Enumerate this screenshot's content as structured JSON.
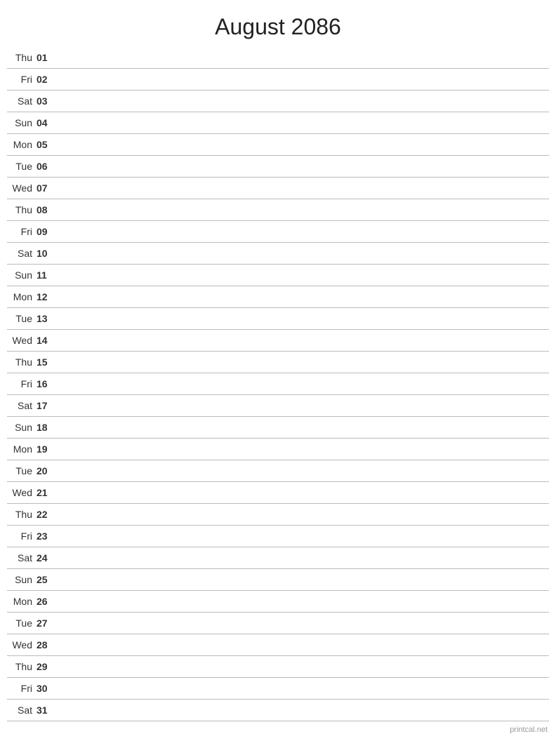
{
  "header": {
    "title": "August 2086"
  },
  "days": [
    {
      "name": "Thu",
      "number": "01"
    },
    {
      "name": "Fri",
      "number": "02"
    },
    {
      "name": "Sat",
      "number": "03"
    },
    {
      "name": "Sun",
      "number": "04"
    },
    {
      "name": "Mon",
      "number": "05"
    },
    {
      "name": "Tue",
      "number": "06"
    },
    {
      "name": "Wed",
      "number": "07"
    },
    {
      "name": "Thu",
      "number": "08"
    },
    {
      "name": "Fri",
      "number": "09"
    },
    {
      "name": "Sat",
      "number": "10"
    },
    {
      "name": "Sun",
      "number": "11"
    },
    {
      "name": "Mon",
      "number": "12"
    },
    {
      "name": "Tue",
      "number": "13"
    },
    {
      "name": "Wed",
      "number": "14"
    },
    {
      "name": "Thu",
      "number": "15"
    },
    {
      "name": "Fri",
      "number": "16"
    },
    {
      "name": "Sat",
      "number": "17"
    },
    {
      "name": "Sun",
      "number": "18"
    },
    {
      "name": "Mon",
      "number": "19"
    },
    {
      "name": "Tue",
      "number": "20"
    },
    {
      "name": "Wed",
      "number": "21"
    },
    {
      "name": "Thu",
      "number": "22"
    },
    {
      "name": "Fri",
      "number": "23"
    },
    {
      "name": "Sat",
      "number": "24"
    },
    {
      "name": "Sun",
      "number": "25"
    },
    {
      "name": "Mon",
      "number": "26"
    },
    {
      "name": "Tue",
      "number": "27"
    },
    {
      "name": "Wed",
      "number": "28"
    },
    {
      "name": "Thu",
      "number": "29"
    },
    {
      "name": "Fri",
      "number": "30"
    },
    {
      "name": "Sat",
      "number": "31"
    }
  ],
  "watermark": "printcal.net"
}
